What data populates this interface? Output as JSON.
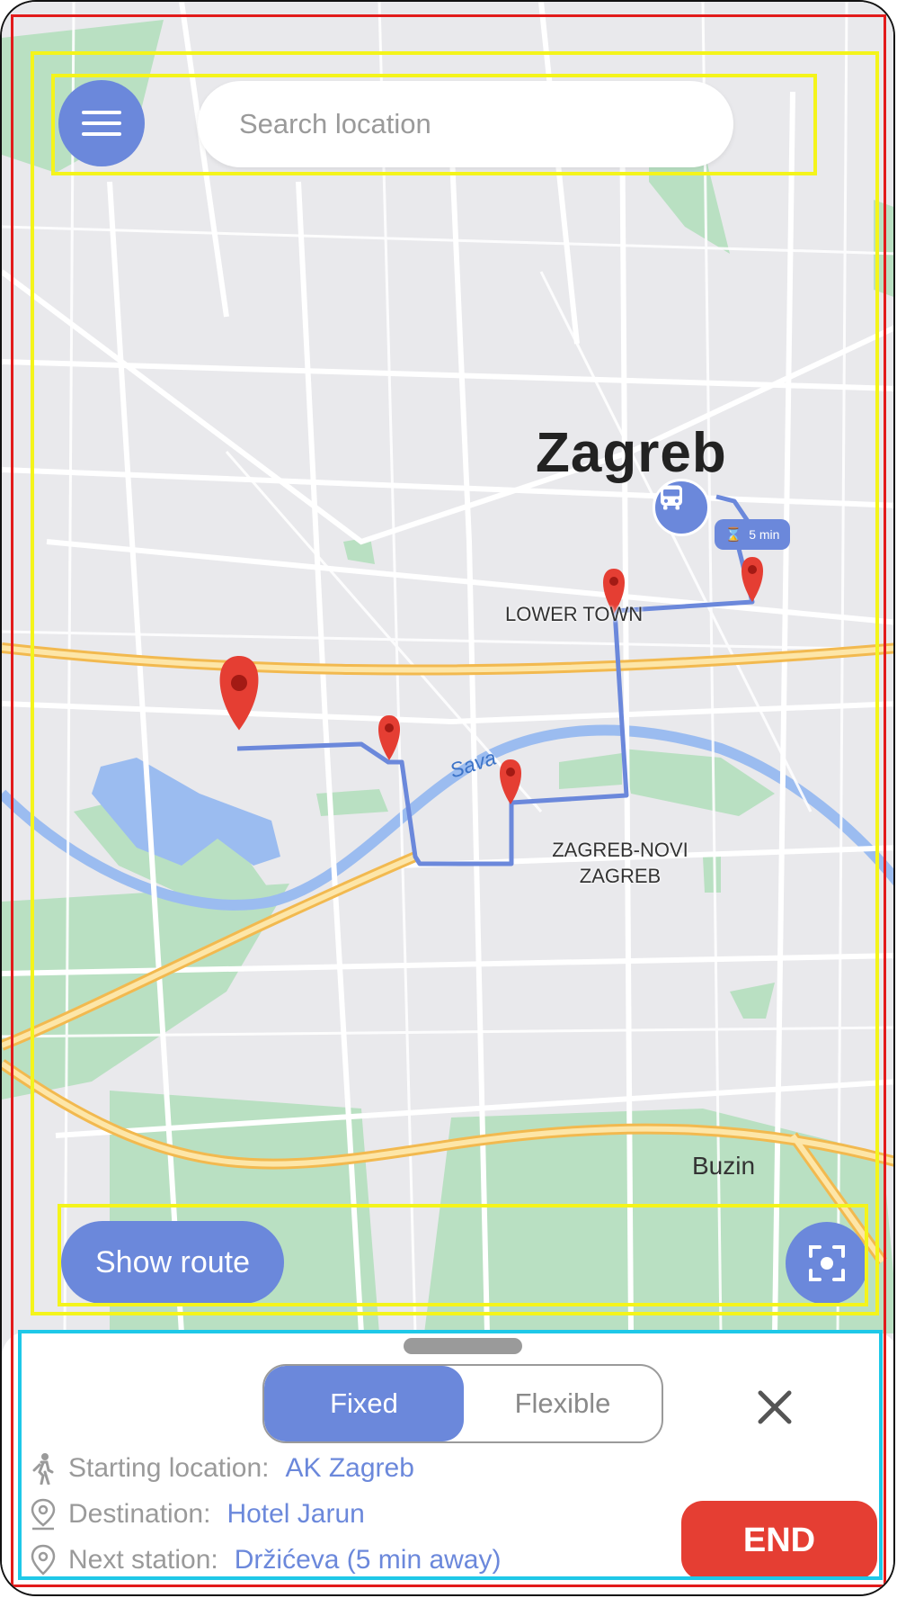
{
  "search": {
    "placeholder": "Search location"
  },
  "map": {
    "city_label": "Zagreb",
    "district_lower_town": "LOWER TOWN",
    "district_novi_line1": "ZAGREB-NOVI",
    "district_novi_line2": "ZAGREB",
    "town_buzin": "Buzin",
    "river_label": "Sava",
    "bus_eta": "5 min"
  },
  "controls": {
    "show_route_label": "Show route"
  },
  "sheet": {
    "mode_options": [
      "Fixed",
      "Flexible"
    ],
    "selected_mode": "Fixed",
    "info": {
      "starting_key": "Starting location:",
      "starting_value": "AK Zagreb",
      "destination_key": "Destination:",
      "destination_value": "Hotel Jarun",
      "next_key": "Next station:",
      "next_value": "Držićeva (5 min away)"
    },
    "end_label": "END"
  },
  "colors": {
    "accent": "#6b88db",
    "end_button": "#e53e33",
    "route_line": "#6b88db",
    "marker": "#e53e33",
    "highway": "#f7c86a",
    "park": "#b9e0c2",
    "river": "#9bbcf0"
  }
}
